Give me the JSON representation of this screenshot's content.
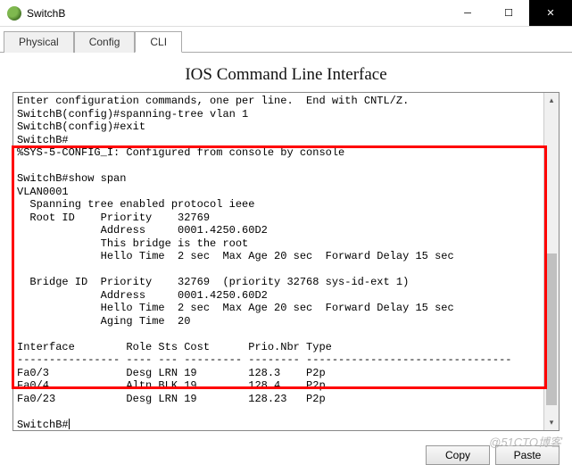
{
  "window": {
    "title": "SwitchB"
  },
  "tabs": {
    "t0": "Physical",
    "t1": "Config",
    "t2": "CLI"
  },
  "cli": {
    "heading": "IOS Command Line Interface",
    "output": "Enter configuration commands, one per line.  End with CNTL/Z.\nSwitchB(config)#spanning-tree vlan 1\nSwitchB(config)#exit\nSwitchB#\n%SYS-5-CONFIG_I: Configured from console by console\n\nSwitchB#show span\nVLAN0001\n  Spanning tree enabled protocol ieee\n  Root ID    Priority    32769\n             Address     0001.4250.60D2\n             This bridge is the root\n             Hello Time  2 sec  Max Age 20 sec  Forward Delay 15 sec\n\n  Bridge ID  Priority    32769  (priority 32768 sys-id-ext 1)\n             Address     0001.4250.60D2\n             Hello Time  2 sec  Max Age 20 sec  Forward Delay 15 sec\n             Aging Time  20\n\nInterface        Role Sts Cost      Prio.Nbr Type\n---------------- ---- --- --------- -------- --------------------------------\nFa0/3            Desg LRN 19        128.3    P2p\nFa0/4            Altn BLK 19        128.4    P2p\nFa0/23           Desg LRN 19        128.23   P2p\n\nSwitchB#"
  },
  "buttons": {
    "copy": "Copy",
    "paste": "Paste"
  },
  "watermark": "@51CTO博客"
}
